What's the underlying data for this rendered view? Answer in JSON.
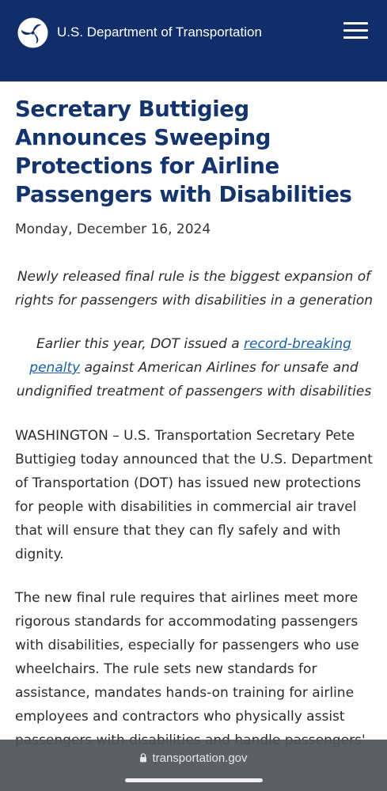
{
  "header": {
    "org_name": "U.S. Department of Transportation",
    "logo_icon": "dot-triskelion-logo",
    "menu_icon": "hamburger-menu-icon",
    "background_color": "#112e6b"
  },
  "article": {
    "title": "Secretary Buttigieg Announces Sweeping Protections for Airline Passengers with Disabilities",
    "date": "Monday, December 16, 2024",
    "subhead_1": "Newly released final rule is the biggest expansion of rights for passengers with disabilities in a generation",
    "subhead_2_before": "Earlier this year, DOT issued a ",
    "subhead_2_link": "record-breaking penalty",
    "subhead_2_after": " against American Airlines for unsafe and undignified treatment of passengers with disabilities",
    "paragraph_1": "WASHINGTON – U.S. Transportation Secretary Pete Buttigieg today announced that the U.S. Department of Transportation (DOT) has issued new protections for people with disabilities in commercial air travel that will ensure that they can fly safely and with dignity.",
    "paragraph_2": "The new final rule requires that airlines meet more rigorous standards for accommodating passengers with disabilities, especially for passengers who use wheelchairs. The rule sets new standards for assistance, mandates hands-on training for airline employees and contractors who physically assist passengers with disabilities and handle passengers'",
    "title_color": "#14346e",
    "link_color": "#1a5fa8"
  },
  "browser": {
    "url": "transportation.gov",
    "lock_icon": "lock-icon"
  }
}
